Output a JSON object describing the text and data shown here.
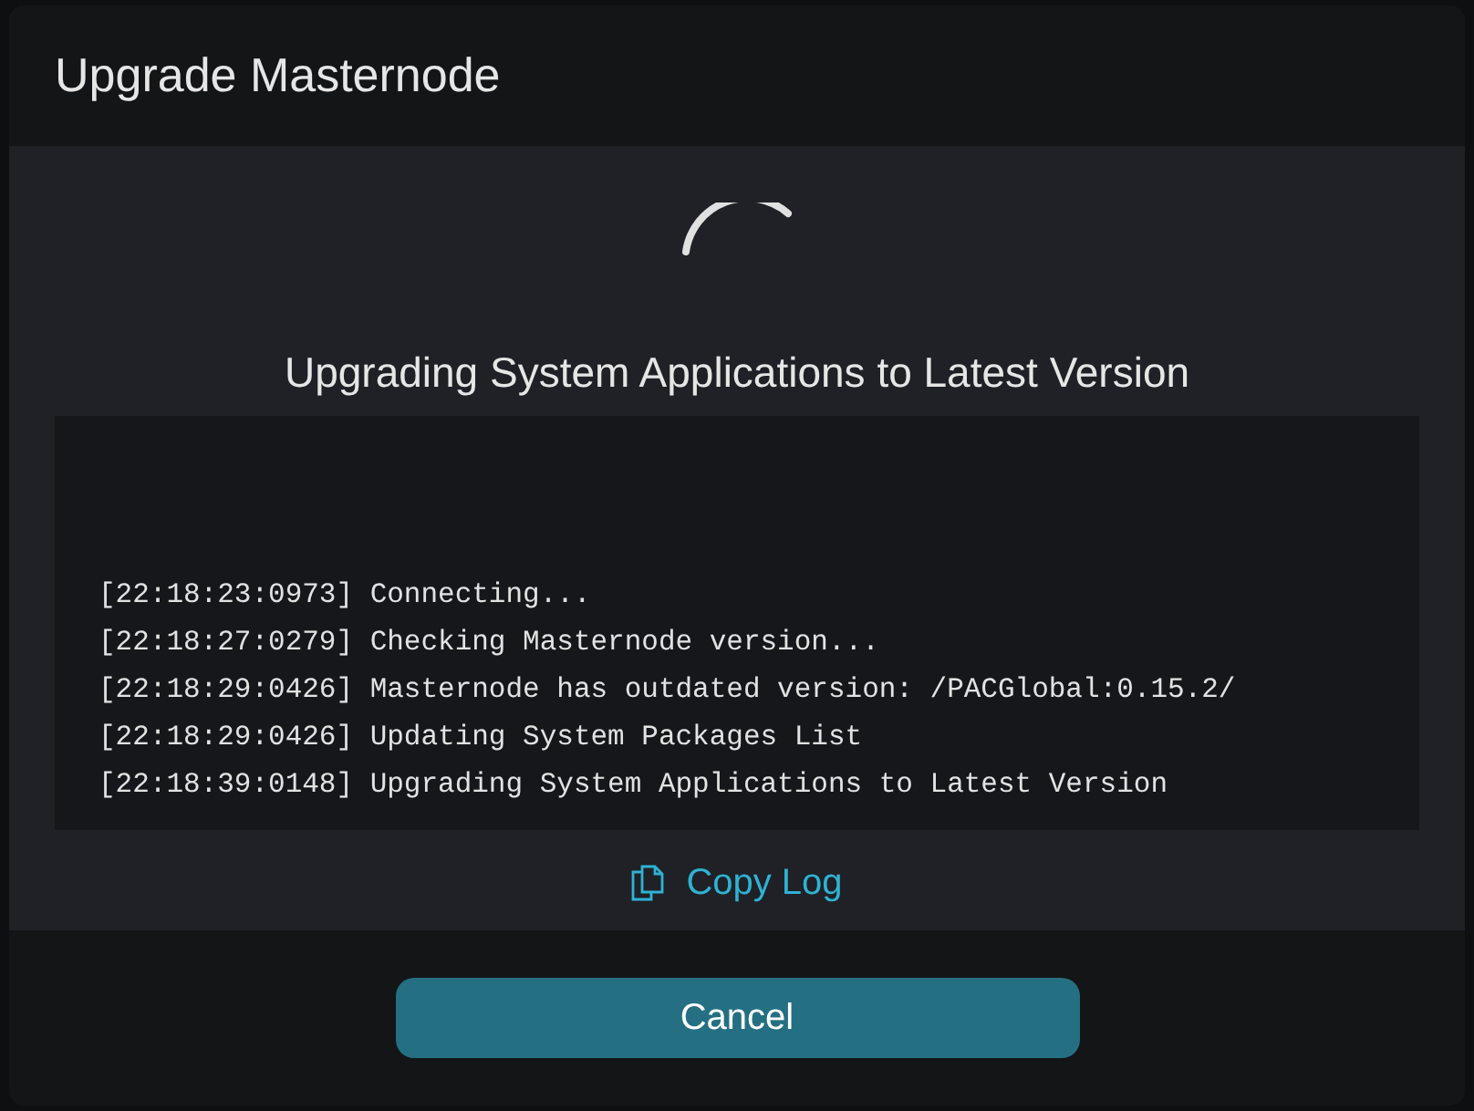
{
  "dialog": {
    "title": "Upgrade Masternode"
  },
  "status": {
    "busy": true,
    "message": "Upgrading System Applications to Latest Version"
  },
  "log": [
    "[22:18:23:0973] Connecting...",
    "[22:18:27:0279] Checking Masternode version...",
    "[22:18:29:0426] Masternode has outdated version: /PACGlobal:0.15.2/",
    "[22:18:29:0426] Updating System Packages List",
    "[22:18:39:0148] Upgrading System Applications to Latest Version"
  ],
  "copy_link": {
    "label": "Copy Log"
  },
  "buttons": [
    {
      "label": "Cancel"
    }
  ]
}
